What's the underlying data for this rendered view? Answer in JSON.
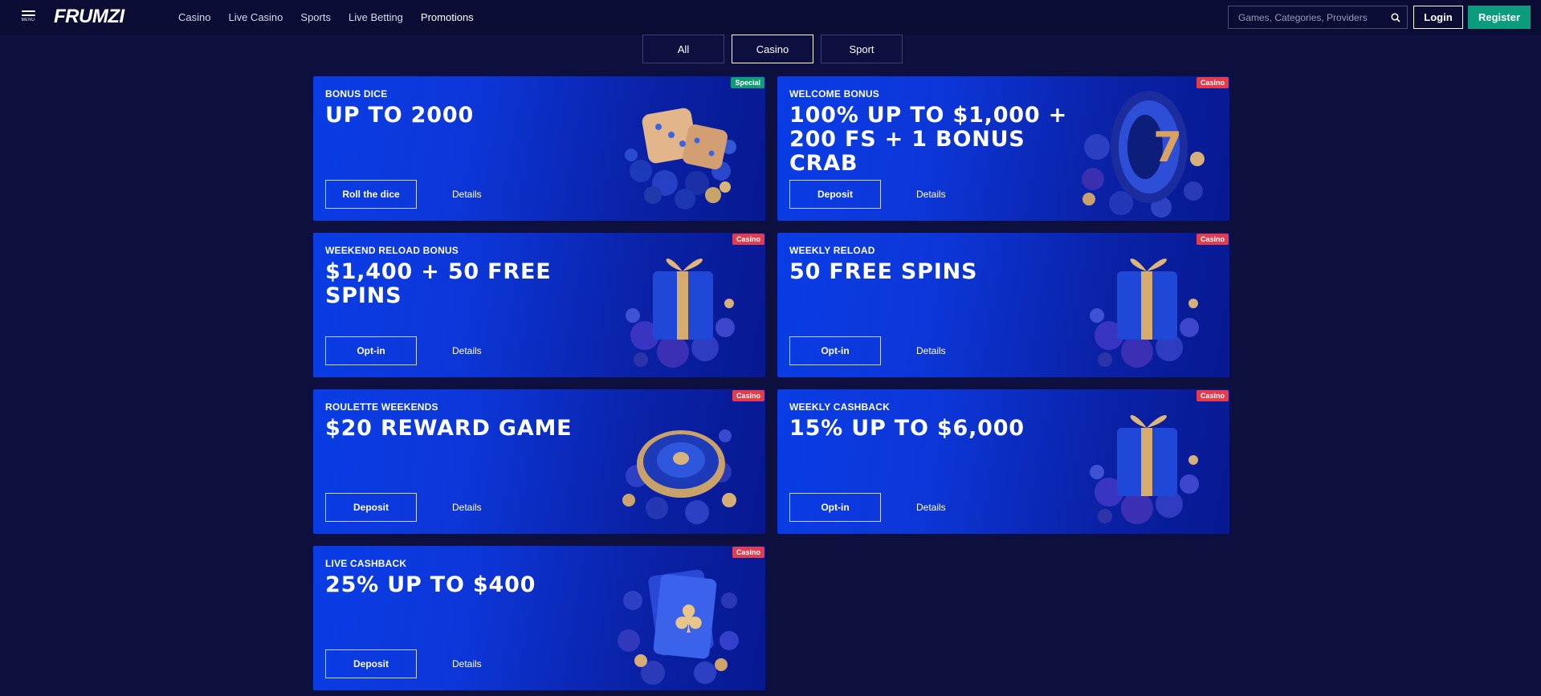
{
  "header": {
    "menu_label": "MENU",
    "logo": "FRUMZI",
    "nav": [
      "Casino",
      "Live Casino",
      "Sports",
      "Live Betting",
      "Promotions"
    ],
    "search_placeholder": "Games, Categories, Providers",
    "login_label": "Login",
    "register_label": "Register",
    "accent": "#0a9c7c"
  },
  "tabs": [
    {
      "label": "All",
      "active": false
    },
    {
      "label": "Casino",
      "active": true
    },
    {
      "label": "Sport",
      "active": false
    }
  ],
  "promos": [
    {
      "badge": "Special",
      "badge_type": "special",
      "kicker": "BONUS DICE",
      "headline": "UP TO 2000",
      "cta": "Roll the dice",
      "details": "Details",
      "art": "dice-art"
    },
    {
      "badge": "Casino",
      "badge_type": "casino",
      "kicker": "WELCOME BONUS",
      "headline": "100% UP TO $1,000 + 200 FS + 1 BONUS CRAB",
      "cta": "Deposit",
      "details": "Details",
      "art": "slot-seven-art"
    },
    {
      "badge": "Casino",
      "badge_type": "casino",
      "kicker": "WEEKEND RELOAD BONUS",
      "headline": "$1,400 + 50 FREE SPINS",
      "cta": "Opt-in",
      "details": "Details",
      "art": "gift-box-art"
    },
    {
      "badge": "Casino",
      "badge_type": "casino",
      "kicker": "WEEKLY RELOAD",
      "headline": "50 FREE SPINS",
      "cta": "Opt-in",
      "details": "Details",
      "art": "gift-box-art"
    },
    {
      "badge": "Casino",
      "badge_type": "casino",
      "kicker": "ROULETTE WEEKENDS",
      "headline": "$20 REWARD GAME",
      "cta": "Deposit",
      "details": "Details",
      "art": "roulette-art"
    },
    {
      "badge": "Casino",
      "badge_type": "casino",
      "kicker": "WEEKLY CASHBACK",
      "headline": "15% UP TO $6,000",
      "cta": "Opt-in",
      "details": "Details",
      "art": "gift-box-art"
    },
    {
      "badge": "Casino",
      "badge_type": "casino",
      "kicker": "LIVE CASHBACK",
      "headline": "25% UP TO $400",
      "cta": "Deposit",
      "details": "Details",
      "art": "cards-art"
    }
  ]
}
